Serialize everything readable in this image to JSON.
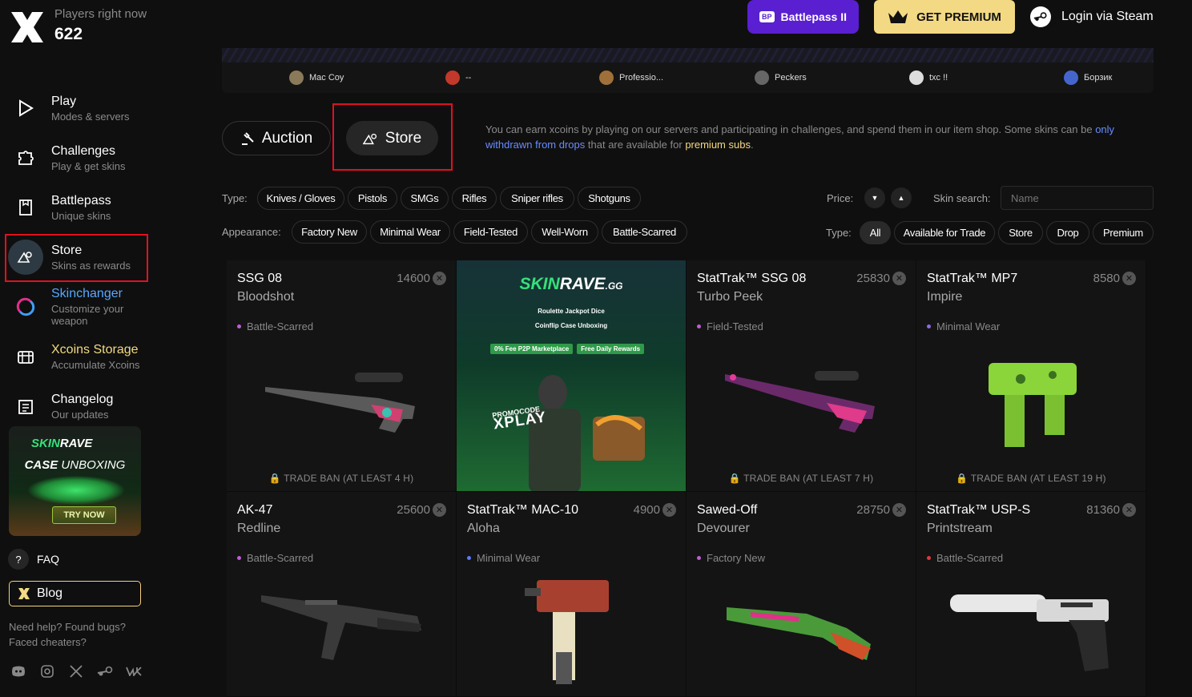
{
  "header": {
    "players_label": "Players right now",
    "players_count": "622",
    "battlepass_badge": "BP",
    "battlepass_label": "Battlepass II",
    "premium_label": "GET PREMIUM",
    "login_label": "Login via Steam"
  },
  "sidebar": {
    "items": [
      {
        "title": "Play",
        "subtitle": "Modes & servers",
        "icon": "play-icon"
      },
      {
        "title": "Challenges",
        "subtitle": "Play & get skins",
        "icon": "puzzle-icon"
      },
      {
        "title": "Battlepass",
        "subtitle": "Unique skins",
        "icon": "bookmark-icon"
      },
      {
        "title": "Store",
        "subtitle": "Skins as rewards",
        "icon": "store-icon"
      },
      {
        "title": "Skinchanger",
        "subtitle": "Customize your weapon",
        "icon": "skinchanger-icon"
      },
      {
        "title": "Xcoins Storage",
        "subtitle": "Accumulate Xcoins",
        "icon": "storage-icon"
      },
      {
        "title": "Changelog",
        "subtitle": "Our updates",
        "icon": "changelog-icon"
      }
    ],
    "promo": {
      "brand_a": "SKIN",
      "brand_b": "RAVE",
      "line1": "CASE",
      "line2": "UNBOXING",
      "cta": "TRY NOW"
    },
    "faq": "FAQ",
    "faq_icon": "?",
    "blog": "Blog",
    "help_line1": "Need help? Found bugs?",
    "help_line2": "Faced cheaters?"
  },
  "drops": [
    {
      "name": "Mac Coy",
      "color": "#8a7a5a"
    },
    {
      "name": "--",
      "color": "#c0392b"
    },
    {
      "name": "Professio...",
      "color": "#a0703a"
    },
    {
      "name": "Peckers",
      "color": "#666666"
    },
    {
      "name": "txc !!",
      "color": "#dddddd"
    },
    {
      "name": "Борзик",
      "color": "#4466cc"
    }
  ],
  "tabs": {
    "auction": "Auction",
    "store": "Store"
  },
  "info": {
    "part1": "You can earn xcoins by playing on our servers and participating in challenges, and spend them in our item shop. Some skins can be ",
    "link": "only withdrawn from drops",
    "part2": " that are available for ",
    "gold": "premium subs",
    "part3": "."
  },
  "filters": {
    "type_label": "Type:",
    "types": [
      "Knives / Gloves",
      "Pistols",
      "SMGs",
      "Rifles",
      "Sniper rifles",
      "Shotguns"
    ],
    "appearance_label": "Appearance:",
    "appearances": [
      "Factory New",
      "Minimal Wear",
      "Field-Tested",
      "Well-Worn",
      "Battle-Scarred"
    ],
    "price_label": "Price:",
    "skin_search_label": "Skin search:",
    "search_placeholder": "Name",
    "type2_label": "Type:",
    "type2": [
      "All",
      "Available for Trade",
      "Store",
      "Drop",
      "Premium"
    ]
  },
  "ad": {
    "brand_a": "SKIN",
    "brand_b": "RAVE",
    "brand_c": ".GG",
    "games_line1": "Roulette   Jackpot   Dice",
    "games_line2": "Coinflip   Case Unboxing",
    "pill1": "0% Fee P2P Marketplace",
    "pill2": "Free Daily Rewards",
    "promo_label": "PROMOCODE",
    "promo_code": "XPLAY"
  },
  "items": [
    {
      "name": "SSG 08",
      "skin": "Bloodshot",
      "price": "14600",
      "wear": "Battle-Scarred",
      "wear_color": "#c05cd6",
      "ban": "TRADE BAN (AT LEAST 4 H)"
    },
    {
      "name": "StatTrak™ SSG 08",
      "skin": "Turbo Peek",
      "price": "25830",
      "wear": "Field-Tested",
      "wear_color": "#c05cd6",
      "ban": "TRADE BAN (AT LEAST 7 H)"
    },
    {
      "name": "StatTrak™ MP7",
      "skin": "Impire",
      "price": "8580",
      "wear": "Minimal Wear",
      "wear_color": "#8b6ae6",
      "ban": "TRADE BAN (AT LEAST 19 H)"
    },
    {
      "name": "AK-47",
      "skin": "Redline",
      "price": "25600",
      "wear": "Battle-Scarred",
      "wear_color": "#c05cd6",
      "ban": ""
    },
    {
      "name": "StatTrak™ MAC-10",
      "skin": "Aloha",
      "price": "4900",
      "wear": "Minimal Wear",
      "wear_color": "#5b7cf0",
      "ban": ""
    },
    {
      "name": "Sawed-Off",
      "skin": "Devourer",
      "price": "28750",
      "wear": "Factory New",
      "wear_color": "#c05cd6",
      "ban": ""
    },
    {
      "name": "StatTrak™ USP-S",
      "skin": "Printstream",
      "price": "81360",
      "wear": "Battle-Scarred",
      "wear_color": "#e0393e",
      "ban": ""
    }
  ]
}
